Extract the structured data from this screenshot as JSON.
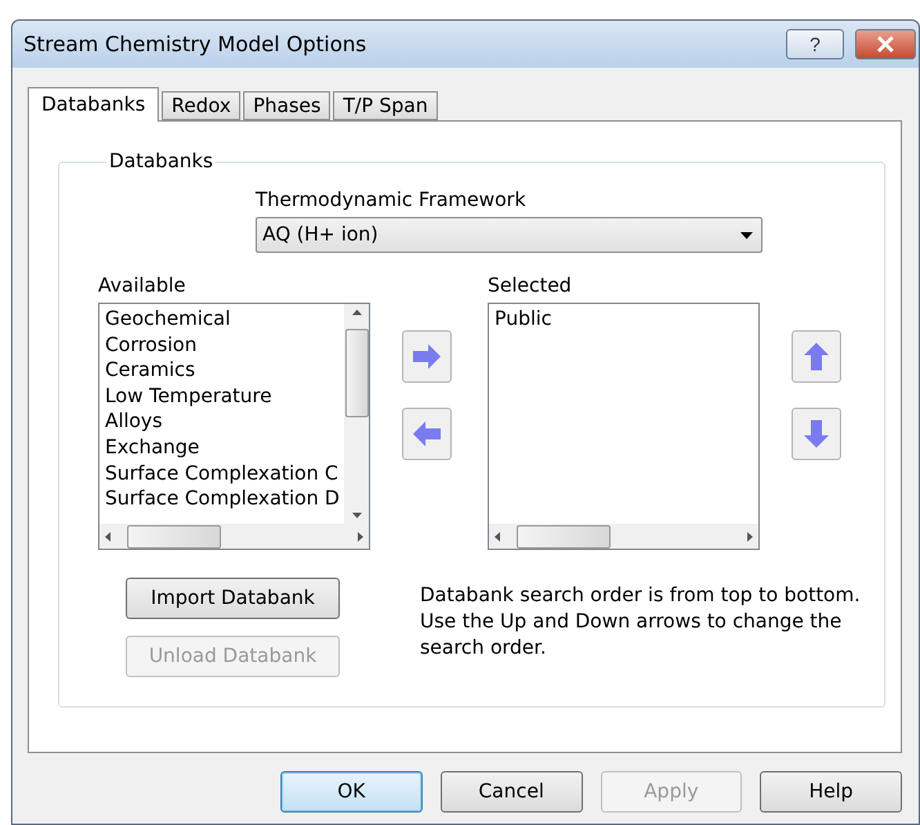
{
  "window": {
    "title": "Stream Chemistry Model Options",
    "help_button": "?"
  },
  "tabs": [
    {
      "label": "Databanks",
      "selected": true
    },
    {
      "label": "Redox",
      "selected": false
    },
    {
      "label": "Phases",
      "selected": false
    },
    {
      "label": "T/P Span",
      "selected": false
    }
  ],
  "group": {
    "legend": "Databanks"
  },
  "framework": {
    "label": "Thermodynamic Framework",
    "value": "AQ (H+ ion)"
  },
  "available": {
    "label": "Available",
    "items": [
      "Geochemical",
      "Corrosion",
      "Ceramics",
      "Low Temperature",
      "Alloys",
      "Exchange",
      "Surface Complexation C",
      "Surface Complexation D"
    ]
  },
  "selected_list": {
    "label": "Selected",
    "items": [
      "Public"
    ]
  },
  "databank_buttons": [
    {
      "label": "Import Databank",
      "disabled": false
    },
    {
      "label": "Unload Databank",
      "disabled": true
    }
  ],
  "note": "Databank search order is from top to bottom. Use the Up and Down arrows to change the search order.",
  "footer_buttons": [
    {
      "label": "OK",
      "disabled": false,
      "default": true
    },
    {
      "label": "Cancel",
      "disabled": false,
      "default": false
    },
    {
      "label": "Apply",
      "disabled": true,
      "default": false
    },
    {
      "label": "Help",
      "disabled": false,
      "default": false
    }
  ]
}
